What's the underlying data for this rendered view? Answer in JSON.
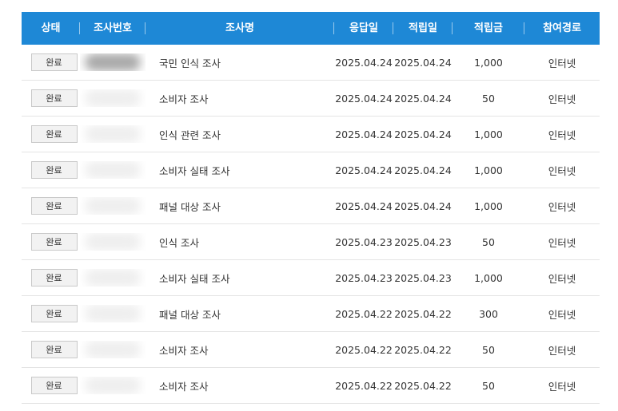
{
  "table": {
    "headers": {
      "status": "상태",
      "survey_id": "조사번호",
      "survey_name": "조사명",
      "response_date": "응답일",
      "accrual_date": "적립일",
      "amount": "적립금",
      "route": "참여경로"
    },
    "rows": [
      {
        "status": "완료",
        "name": "국민 인식 조사",
        "response_date": "2025.04.24",
        "accrual_date": "2025.04.24",
        "amount": "1,000",
        "route": "인터넷"
      },
      {
        "status": "완료",
        "name": "소비자 조사",
        "response_date": "2025.04.24",
        "accrual_date": "2025.04.24",
        "amount": "50",
        "route": "인터넷"
      },
      {
        "status": "완료",
        "name": "인식 관련 조사",
        "response_date": "2025.04.24",
        "accrual_date": "2025.04.24",
        "amount": "1,000",
        "route": "인터넷"
      },
      {
        "status": "완료",
        "name": "소비자 실태 조사",
        "response_date": "2025.04.24",
        "accrual_date": "2025.04.24",
        "amount": "1,000",
        "route": "인터넷"
      },
      {
        "status": "완료",
        "name": "패널 대상 조사",
        "response_date": "2025.04.24",
        "accrual_date": "2025.04.24",
        "amount": "1,000",
        "route": "인터넷"
      },
      {
        "status": "완료",
        "name": "인식 조사",
        "response_date": "2025.04.23",
        "accrual_date": "2025.04.23",
        "amount": "50",
        "route": "인터넷"
      },
      {
        "status": "완료",
        "name": "소비자 실태 조사",
        "response_date": "2025.04.23",
        "accrual_date": "2025.04.23",
        "amount": "1,000",
        "route": "인터넷"
      },
      {
        "status": "완료",
        "name": "패널 대상 조사",
        "response_date": "2025.04.22",
        "accrual_date": "2025.04.22",
        "amount": "300",
        "route": "인터넷"
      },
      {
        "status": "완료",
        "name": "소비자 조사",
        "response_date": "2025.04.22",
        "accrual_date": "2025.04.22",
        "amount": "50",
        "route": "인터넷"
      },
      {
        "status": "완료",
        "name": "소비자 조사",
        "response_date": "2025.04.22",
        "accrual_date": "2025.04.22",
        "amount": "50",
        "route": "인터넷"
      }
    ]
  },
  "colors": {
    "header_bg": "#1e88d6",
    "header_text": "#ffffff",
    "row_divider": "#e4e4e4",
    "badge_bg": "#f2f2f2"
  }
}
